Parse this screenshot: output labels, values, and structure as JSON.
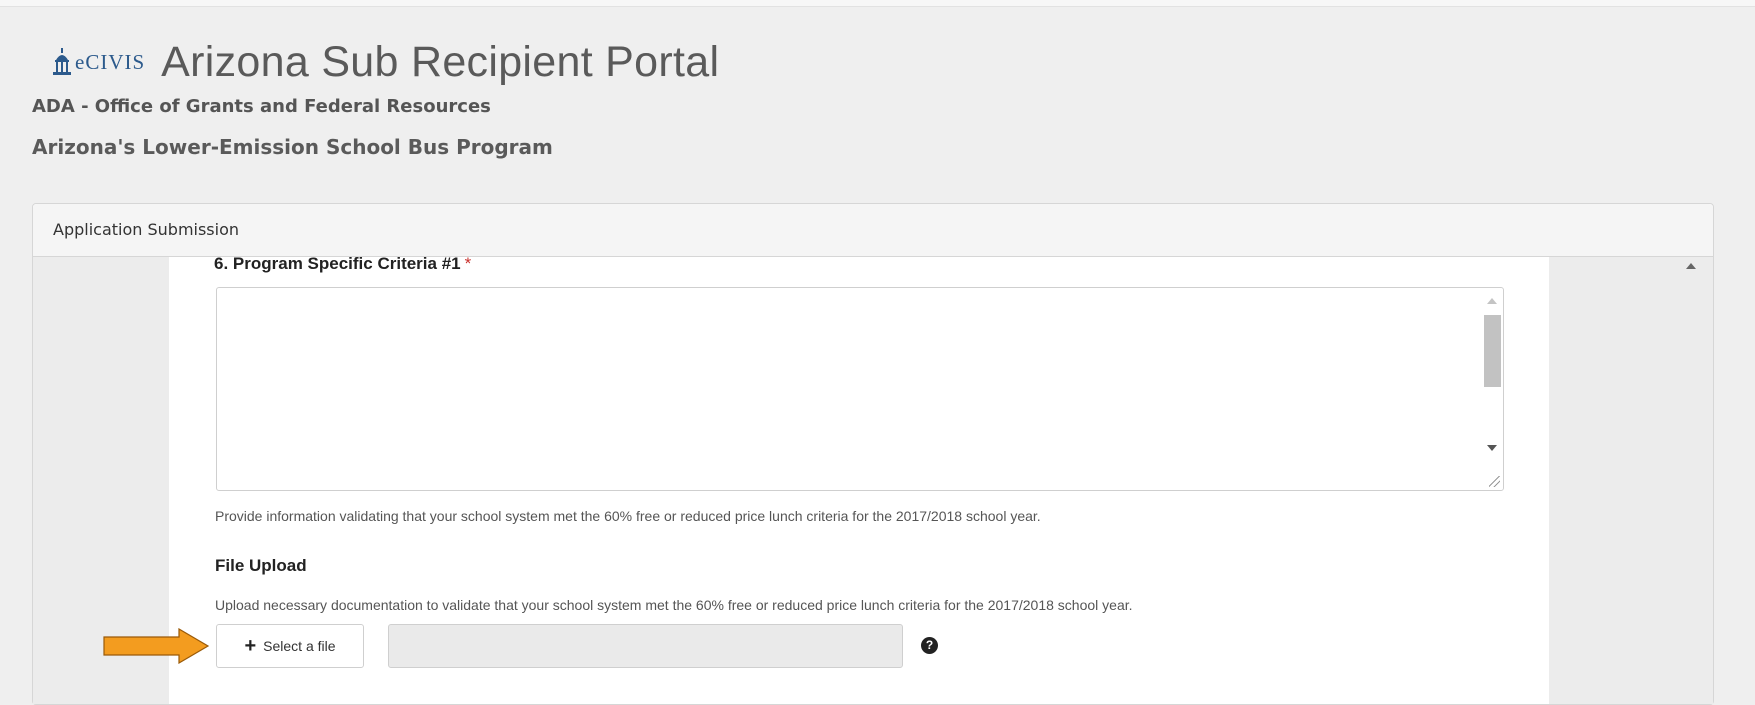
{
  "header": {
    "logo_text": "eCIVIS",
    "portal_title": "Arizona Sub Recipient Portal",
    "organization": "ADA - Office of Grants and Federal Resources",
    "program": "Arizona's Lower-Emission School Bus Program"
  },
  "panel": {
    "title": "Application Submission"
  },
  "question": {
    "label": "6. Program Specific Criteria #1",
    "required_marker": "*",
    "answer_value": "",
    "help_text": "Provide information validating that your school system met the 60% free or reduced price lunch criteria for the 2017/2018 school year."
  },
  "file_upload": {
    "label": "File Upload",
    "help_text": "Upload necessary documentation to validate that your school system met the 60% free or reduced price lunch criteria for the 2017/2018 school year.",
    "button_label": "Select a file",
    "button_icon": "plus-icon",
    "file_name_value": "",
    "help_icon": "question-circle-icon"
  },
  "colors": {
    "accent_arrow": "#f39c1f",
    "required": "#c9302c",
    "logo_blue": "#2c5a8c"
  }
}
